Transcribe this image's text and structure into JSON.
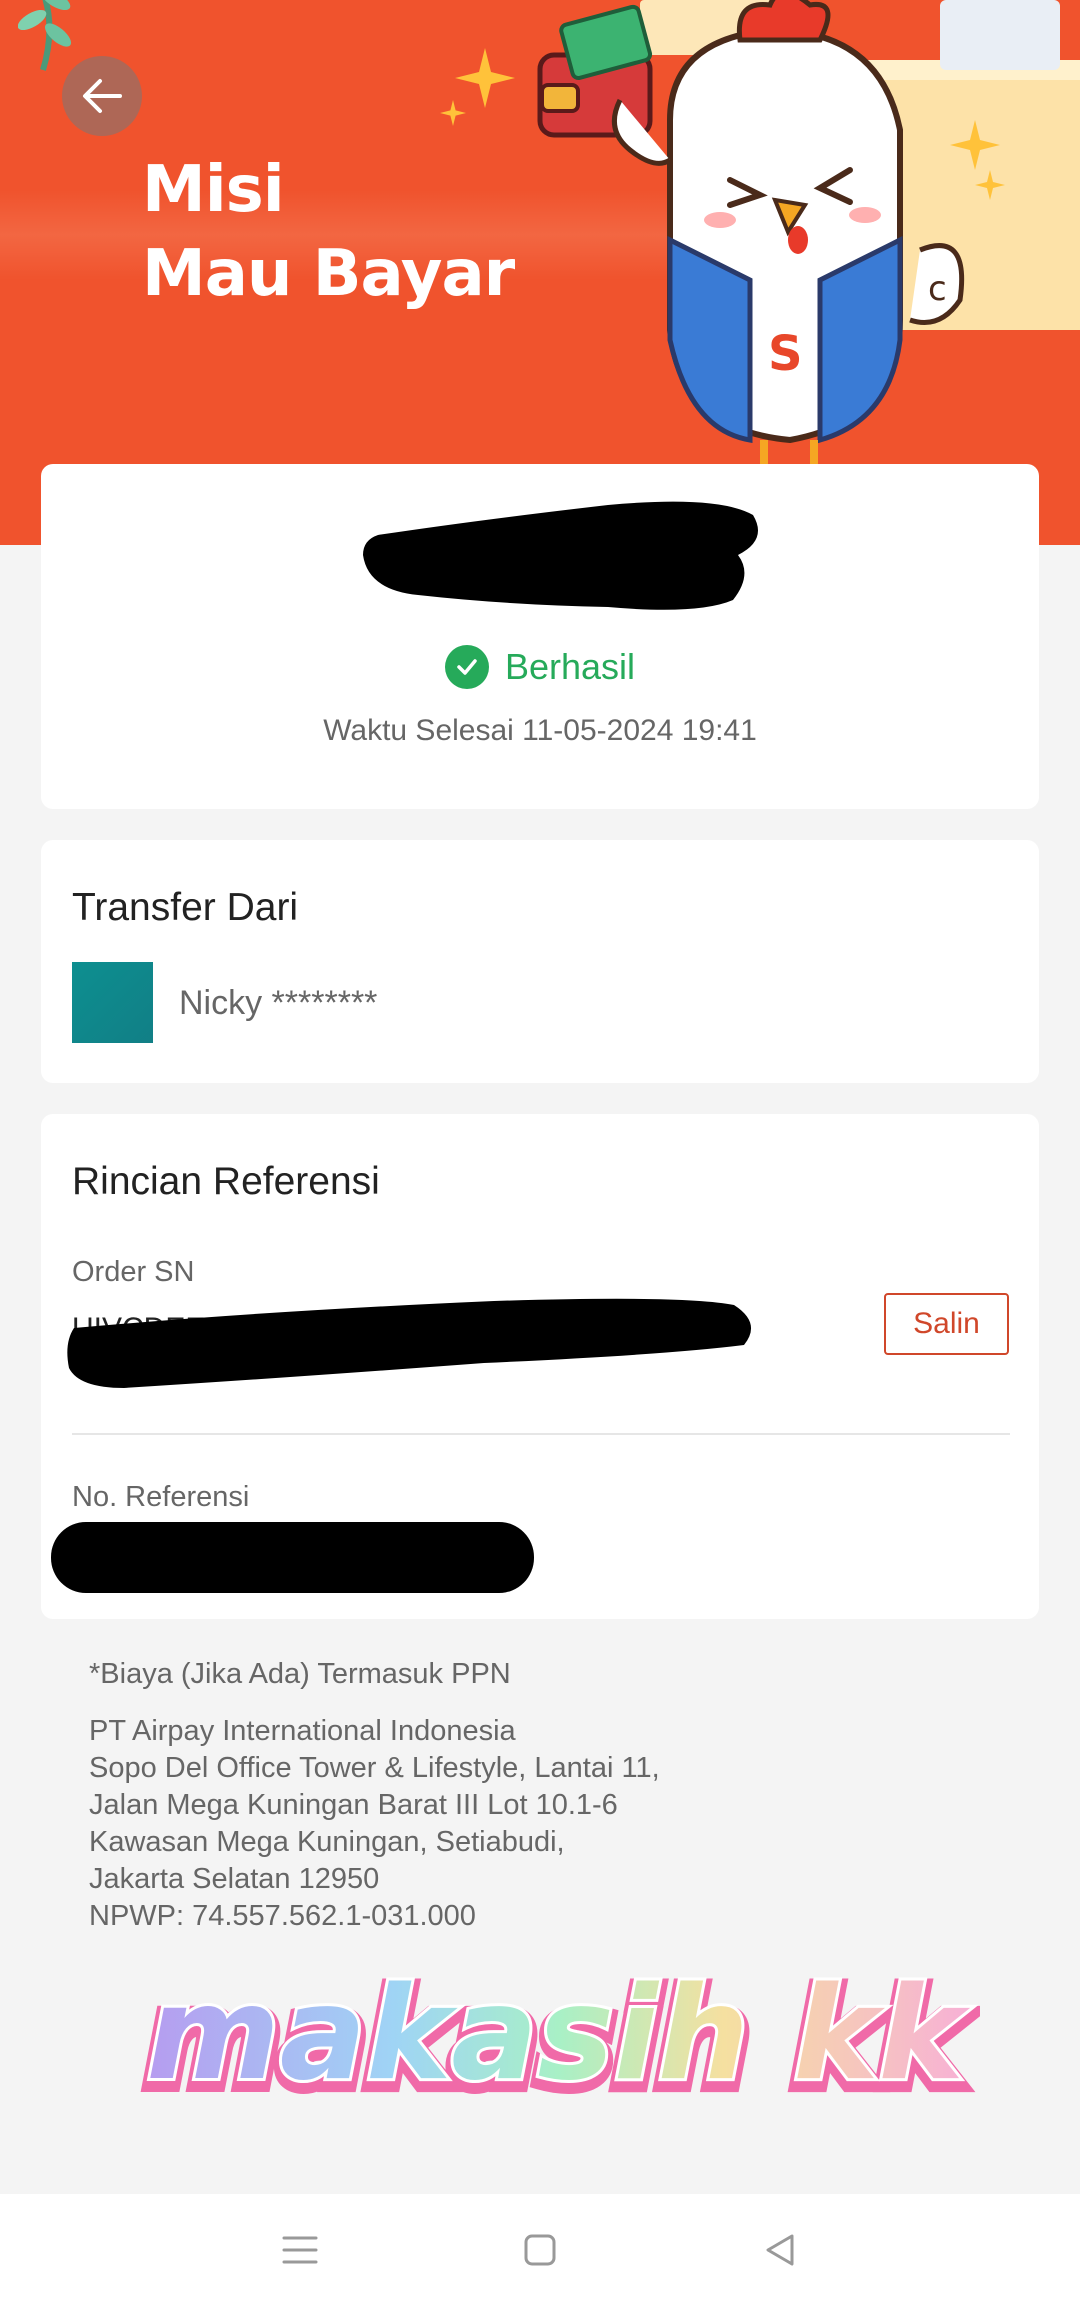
{
  "banner": {
    "title_line1": "Misi",
    "title_line2": "Mau Bayar"
  },
  "status": {
    "text": "Berhasil",
    "finish_time": "Waktu Selesai 11-05-2024 19:41",
    "color": "#26aa5a"
  },
  "transfer_from": {
    "title": "Transfer Dari",
    "name": "Nicky ********"
  },
  "reference": {
    "title": "Rincian Referensi",
    "order_sn_label": "Order SN",
    "order_sn_value": "UIVCDEE",
    "copy_label": "Salin",
    "ref_no_label": "No. Referensi"
  },
  "footer": {
    "fee_note": "*Biaya (Jika Ada) Termasuk PPN",
    "company_lines": [
      "PT Airpay International Indonesia",
      "Sopo Del Office Tower & Lifestyle, Lantai 11,",
      "Jalan Mega Kuningan Barat III Lot 10.1-6",
      "Kawasan Mega Kuningan, Setiabudi,",
      "Jakarta Selatan 12950",
      "NPWP: 74.557.562.1-031.000"
    ]
  },
  "sticker": {
    "text": "makasih kk"
  },
  "colors": {
    "brand": "#f0532d",
    "accent_button": "#d0472a"
  },
  "icons": {
    "back": "arrow-left-icon",
    "check": "check-circle-icon",
    "nav_menu": "menu-icon",
    "nav_home": "home-square-icon",
    "nav_back": "back-triangle-icon"
  }
}
